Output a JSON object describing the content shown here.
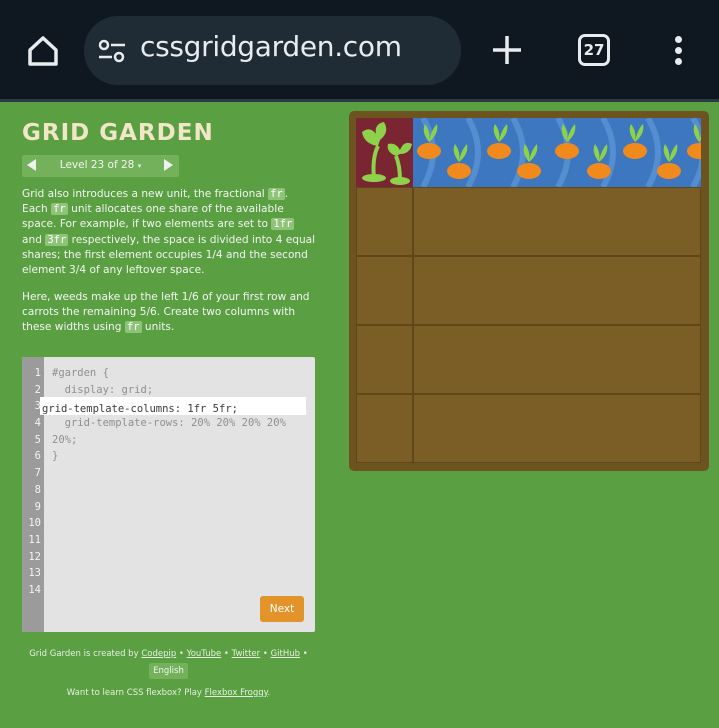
{
  "browser": {
    "url": "cssgridgarden.com",
    "tab_count": "27",
    "icons": [
      "home-icon",
      "site-settings-icon",
      "new-tab-icon",
      "tabs-icon",
      "more-menu-icon"
    ]
  },
  "title": "GRID GARDEN",
  "level": {
    "label": "Level 23 of 28",
    "marker": "▾"
  },
  "instructions": {
    "p1_a": "Grid also introduces a new unit, the fractional ",
    "p1_code1": "fr",
    "p1_b": ". Each ",
    "p1_code2": "fr",
    "p1_c": " unit allocates one share of the available space. For example, if two elements are set to ",
    "p1_code3": "1fr",
    "p1_d": " and ",
    "p1_code4": "3fr",
    "p1_e": " respectively, the space is divided into 4 equal shares; the first element occupies 1/4 and the second element 3/4 of any leftover space.",
    "p2_a": "Here, weeds make up the left 1/6 of your first row and carrots the remaining 5/6. Create two columns with these widths using ",
    "p2_code": "fr",
    "p2_b": " units."
  },
  "editor": {
    "line_numbers": [
      "1",
      "2",
      "3",
      "4",
      "5",
      "6",
      "7",
      "8",
      "9",
      "10",
      "11",
      "12",
      "13",
      "14"
    ],
    "line1": "#garden {",
    "line2": "  display: grid;",
    "input_value": "grid-template-columns: 1fr 5fr;",
    "line4": "  grid-template-rows: 20% 20% 20% 20%",
    "line5": "20%;",
    "line6": "}",
    "next_label": "Next"
  },
  "footer": {
    "created_prefix": "Grid Garden is created by ",
    "codepip": "Codepip",
    "sep": " • ",
    "youtube": "YouTube",
    "twitter": "Twitter",
    "github": "GitHub",
    "language": "English",
    "flexbox_prefix": "Want to learn CSS flexbox? Play ",
    "flexbox_link": "Flexbox Froggy",
    "flexbox_suffix": "."
  },
  "colors": {
    "background": "#5aa042",
    "next_button": "#e2932a",
    "soil": "#7b5e26",
    "water": "#3d77bf",
    "weed_cell": "#7a2532",
    "carrot": "#f08a1c",
    "leaf": "#7ccf3a"
  }
}
